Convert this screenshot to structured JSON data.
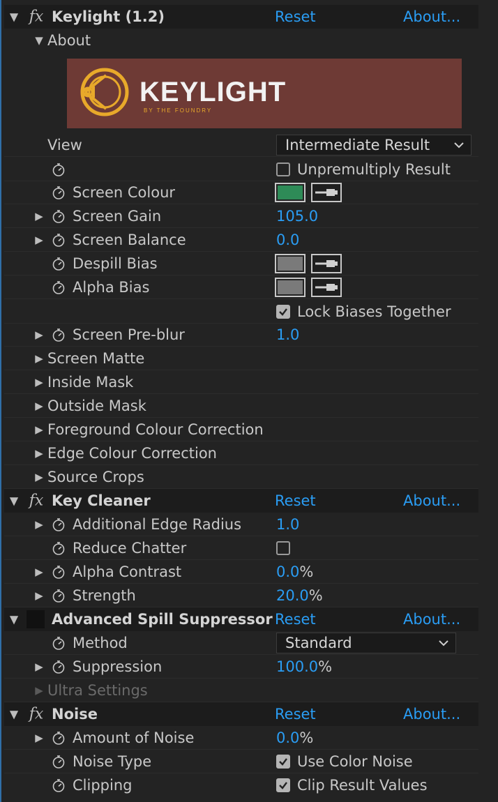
{
  "effects": {
    "keylight": {
      "name": "Keylight (1.2)",
      "reset": "Reset",
      "about": "About...",
      "about_group": "About",
      "logo_text": "KEYLIGHT",
      "logo_sub": "BY THE FOUNDRY",
      "view_label": "View",
      "view_value": "Intermediate Result",
      "unpremultiply_label": "Unpremultiply Result",
      "unpremultiply_checked": false,
      "screen_colour_label": "Screen Colour",
      "screen_colour": "#2e8b57",
      "screen_gain_label": "Screen Gain",
      "screen_gain_value": "105.0",
      "screen_balance_label": "Screen Balance",
      "screen_balance_value": "0.0",
      "despill_bias_label": "Despill Bias",
      "despill_bias_colour": "#7a7a7a",
      "alpha_bias_label": "Alpha Bias",
      "alpha_bias_colour": "#7a7a7a",
      "lock_biases_label": "Lock Biases Together",
      "lock_biases_checked": true,
      "screen_preblur_label": "Screen Pre-blur",
      "screen_preblur_value": "1.0",
      "groups": [
        "Screen Matte",
        "Inside Mask",
        "Outside Mask",
        "Foreground Colour Correction",
        "Edge Colour Correction",
        "Source Crops"
      ]
    },
    "key_cleaner": {
      "name": "Key Cleaner",
      "reset": "Reset",
      "about": "About...",
      "edge_radius_label": "Additional Edge Radius",
      "edge_radius_value": "1.0",
      "reduce_chatter_label": "Reduce Chatter",
      "reduce_chatter_checked": false,
      "alpha_contrast_label": "Alpha Contrast",
      "alpha_contrast_value": "0.0",
      "strength_label": "Strength",
      "strength_value": "20.0",
      "percent": "%"
    },
    "spill": {
      "name": "Advanced Spill Suppressor",
      "reset": "Reset",
      "about": "About...",
      "method_label": "Method",
      "method_value": "Standard",
      "suppression_label": "Suppression",
      "suppression_value": "100.0",
      "percent": "%",
      "ultra_label": "Ultra Settings"
    },
    "noise": {
      "name": "Noise",
      "reset": "Reset",
      "about": "About...",
      "amount_label": "Amount of Noise",
      "amount_value": "0.0",
      "percent": "%",
      "type_label": "Noise Type",
      "type_checkbox_label": "Use Color Noise",
      "type_checked": true,
      "clipping_label": "Clipping",
      "clipping_checkbox_label": "Clip Result Values",
      "clipping_checked": true
    }
  },
  "colors": {
    "link": "#2a9df4",
    "background": "#232323",
    "header_background": "#1c1c1c"
  }
}
